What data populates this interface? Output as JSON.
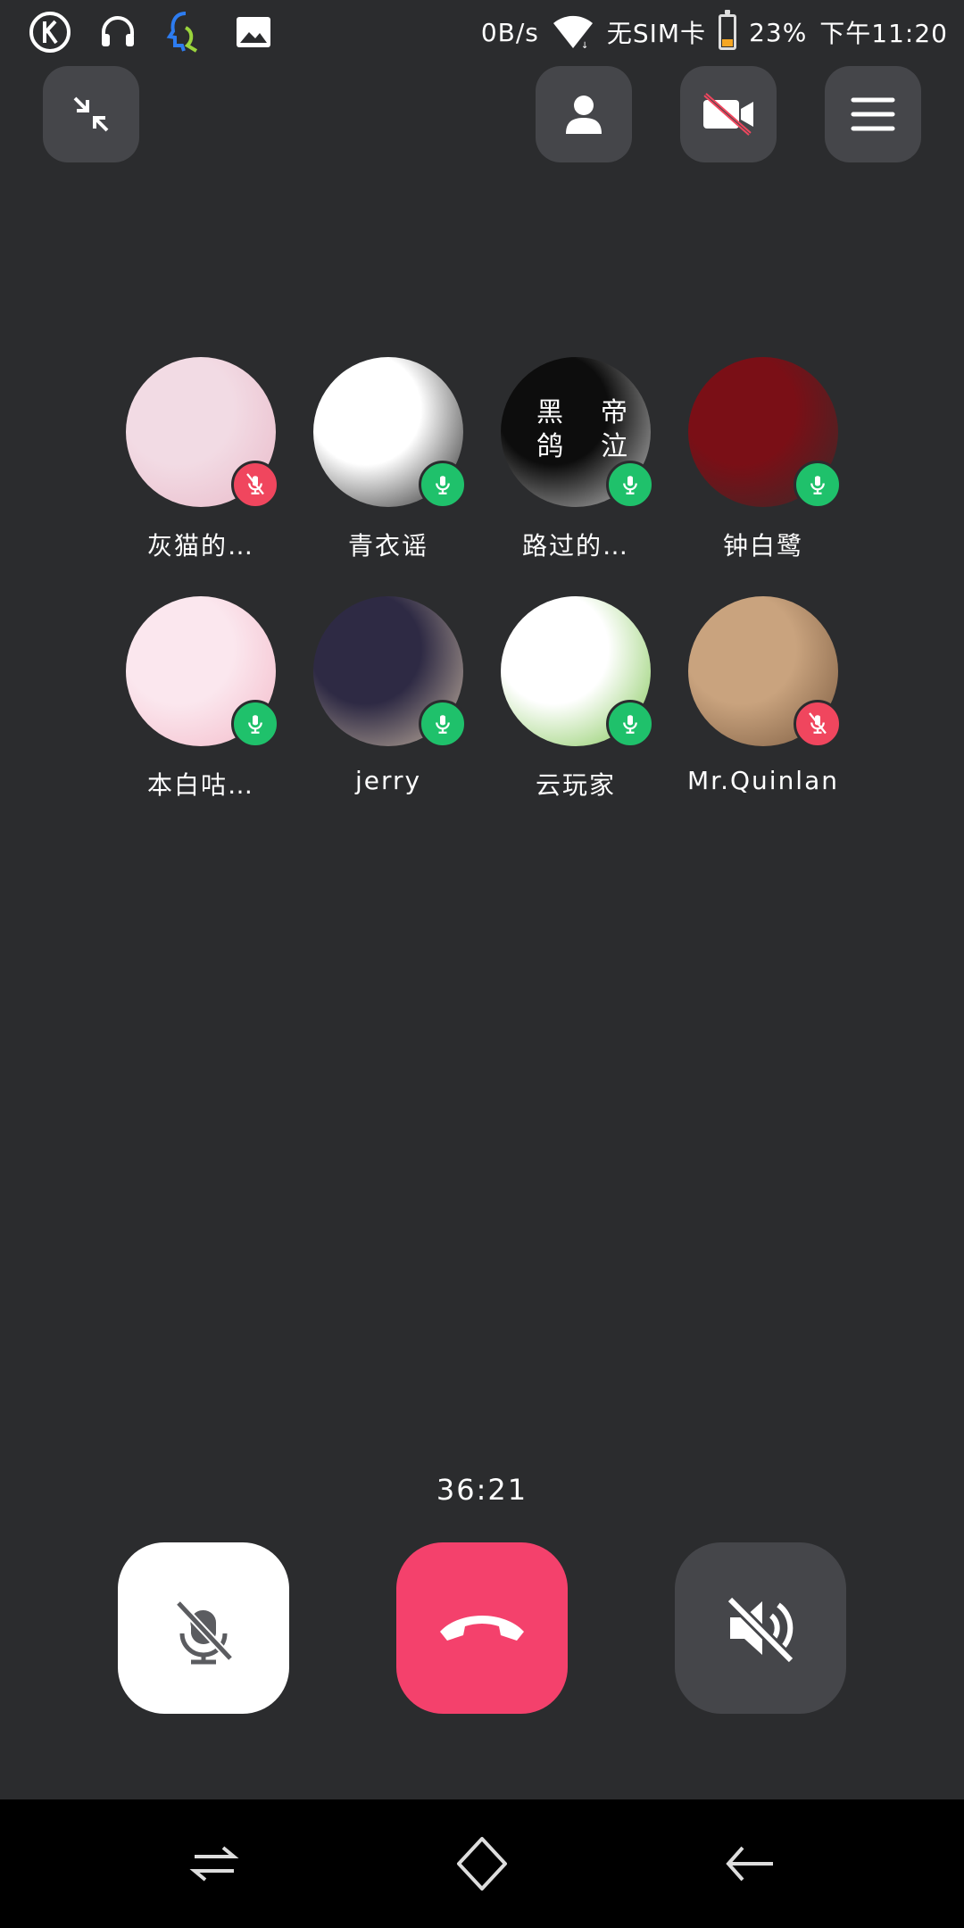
{
  "status_bar": {
    "speed": "0B/s",
    "sim": "无SIM卡",
    "battery": "23%",
    "time": "下午11:20",
    "battery_level": 0.23,
    "icons": [
      "k-app-icon",
      "headset-icon",
      "voice-assistant-icon",
      "image-icon",
      "wifi-icon",
      "battery-icon"
    ]
  },
  "top_controls": [
    "minimize-icon",
    "contact-icon",
    "video-off-icon",
    "menu-icon"
  ],
  "participants": [
    {
      "name": "灰猫的…",
      "muted": true,
      "avatar_colors": [
        "#f2dbe4",
        "#e9b9c8"
      ]
    },
    {
      "name": "青衣谣",
      "muted": false,
      "avatar_colors": [
        "#ffffff",
        "#1b1b1b"
      ]
    },
    {
      "name": "路过的…",
      "muted": false,
      "avatar_colors": [
        "#0d0d0d",
        "#c9c9c9"
      ],
      "avatar_text": [
        "黑",
        "帝",
        "鸽",
        "泣"
      ]
    },
    {
      "name": "钟白鹭",
      "muted": false,
      "avatar_colors": [
        "#7a0f16",
        "#3b2a2a"
      ]
    },
    {
      "name": "本白咕…",
      "muted": false,
      "avatar_colors": [
        "#fbe7ee",
        "#f3b9c8"
      ]
    },
    {
      "name": "jerry",
      "muted": false,
      "avatar_colors": [
        "#2e2a44",
        "#c9b7a3"
      ]
    },
    {
      "name": "云玩家",
      "muted": false,
      "avatar_colors": [
        "#ffffff",
        "#7cc44e"
      ]
    },
    {
      "name": "Mr.Quinlan",
      "muted": true,
      "avatar_colors": [
        "#c9a37e",
        "#7a5a3f"
      ]
    }
  ],
  "call": {
    "duration": "36:21",
    "mute_button": "mute-mic-icon",
    "hangup_button": "hang-up-icon",
    "speaker_button": "speaker-off-icon"
  },
  "colors": {
    "background": "#2b2c2e",
    "mic_on": "#1fc16b",
    "mic_off": "#f0465e",
    "hangup": "#f4416c"
  },
  "nav_bar": [
    "switch-icon",
    "home-icon",
    "back-icon"
  ]
}
